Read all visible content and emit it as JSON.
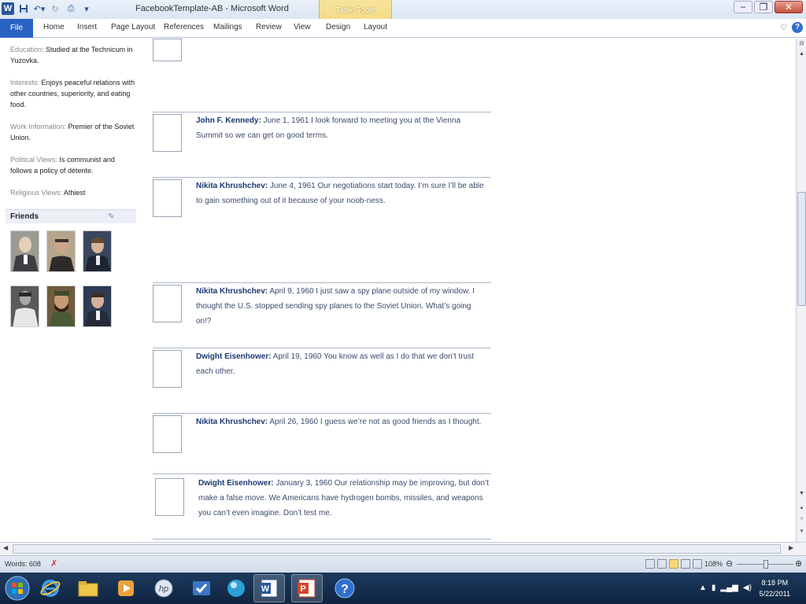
{
  "window": {
    "title": "FacebookTemplate-AB - Microsoft Word",
    "contextual_group": "Table Tools",
    "controls": {
      "minimize": "−",
      "restore": "❐",
      "close": "✕"
    }
  },
  "ribbon": {
    "file": "File",
    "tabs": [
      "Home",
      "Insert",
      "Page Layout",
      "References",
      "Mailings",
      "Review",
      "View",
      "Design",
      "Layout"
    ],
    "help": "?"
  },
  "profile": {
    "education": {
      "label": "Education:",
      "value": "Studied at the Technicum in Yuzovka."
    },
    "interests": {
      "label": "Interests:",
      "value": "Enjoys peaceful relations with other countries, superiority, and eating food."
    },
    "work": {
      "label": "Work Information:",
      "value": "Premier of the Soviet Union."
    },
    "political": {
      "label": "Political Views:",
      "value": "Is communist and follows a policy of détente."
    },
    "religious": {
      "label": "Religious Views:",
      "value": "Athiest"
    }
  },
  "friends": {
    "header": "Friends",
    "photos": [
      "friend-photo-1",
      "friend-photo-2",
      "friend-photo-3",
      "friend-photo-4",
      "friend-photo-5",
      "friend-photo-6"
    ]
  },
  "posts": [
    {
      "author": "John F. Kennedy:",
      "text": " June 1, 1961 I look forward to meeting you at the Vienna Summit so we can get on good terms."
    },
    {
      "author": "Nikita Khrushchev:",
      "text": " June 4, 1961 Our negotiations start today.  I’m sure I’ll be able to gain something out of it because of your noob-ness."
    },
    {
      "author": "Nikita Khrushchev:",
      "text": " April 9, 1960 I just saw a spy plane outside of my window.  I thought the U.S. stopped sending spy planes to the Soviet Union.  What’s going on!?"
    },
    {
      "author": "Dwight Eisenhower:",
      "text": " April 19, 1960 You know as well as I do that we don’t trust each other."
    },
    {
      "author": "Nikita Khrushchev:",
      "text": " April 26, 1960 I guess we’re not as good friends as I thought."
    },
    {
      "author": "Dwight Eisenhower:",
      "text": " January 3, 1960 Our relationship may be improving, but don’t make a false move.  We Americans have hydrogen bombs, missiles, and weapons you can’t even imagine.  Don’t test me."
    }
  ],
  "status": {
    "words": "Words: 608",
    "zoom": "108%",
    "zoom_level": 1.08
  },
  "taskbar": {
    "time": "8:18 PM",
    "date": "5/22/2011"
  },
  "colors": {
    "file_tab": "#2a62c4",
    "table_tools": "#f3dc86",
    "author_blue": "#1b3a70",
    "taskbar": "#1d3a5e"
  }
}
